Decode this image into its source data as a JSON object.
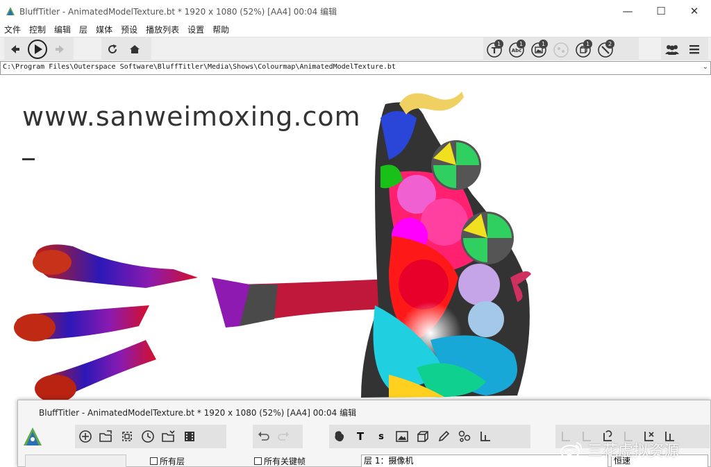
{
  "window": {
    "title": "BluffTitler - AnimatedModelTexture.bt * 1920 x 1080 (52%) [AA4] 00:04 编辑",
    "minimize_glyph": "—",
    "maximize_glyph": "☐",
    "close_glyph": "✕"
  },
  "menu": {
    "items": [
      "文件",
      "控制",
      "编辑",
      "层",
      "媒体",
      "预设",
      "播放列表",
      "设置",
      "帮助"
    ]
  },
  "toolbar": {
    "badges": {
      "text_layer": "1",
      "abc_layer": "1",
      "picture_layer": "1",
      "model_layer": "1",
      "effect_layer": "2"
    },
    "abc_label": "Abc"
  },
  "pathbar": {
    "value": "C:\\Program Files\\Outerspace Software\\BluffTitler\\Media\\Shows\\Colourmap\\AnimatedModelTexture.bt"
  },
  "preview": {
    "overlay_text": "www.sanweimoxing.com"
  },
  "subwindow": {
    "title": "BluffTitler - AnimatedModelTexture.bt * 1920 x 1080 (52%) [AA4] 00:04 编辑",
    "toolbar_text_glyph": "T",
    "toolbar_s_glyph": "s",
    "all_layers_label": "所有层",
    "all_keyframes_label": "所有关键帧",
    "layer_select_value": "层 1：摄像机",
    "speed_select_value": "恒速"
  },
  "watermark": {
    "text": "三花虚拟资源"
  },
  "colors": {
    "accent": "#2d7fd0",
    "toolbar_bg": "#f0f0f0",
    "button_group_bg": "#e6e6e6"
  }
}
